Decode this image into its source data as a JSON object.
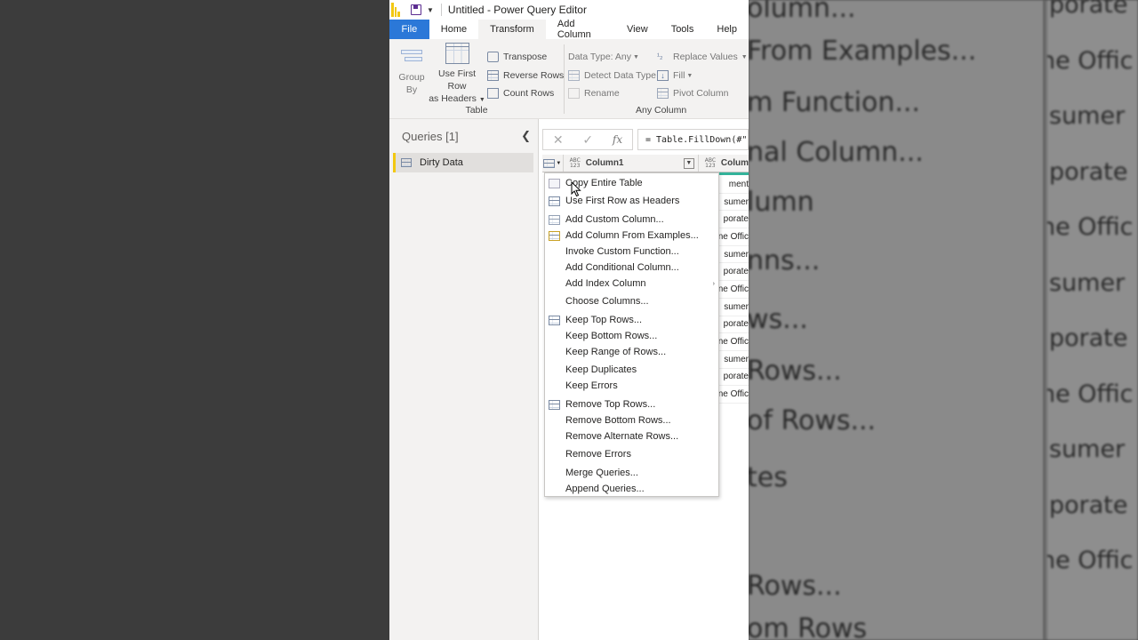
{
  "window": {
    "title": "Untitled - Power Query Editor"
  },
  "tabs": [
    "File",
    "Home",
    "Transform",
    "Add Column",
    "View",
    "Tools",
    "Help"
  ],
  "active_tab": "Transform",
  "ribbon": {
    "group_by": {
      "line1": "Group",
      "line2": "By"
    },
    "use_first_row": {
      "line1": "Use First Row",
      "line2": "as Headers"
    },
    "transpose": "Transpose",
    "reverse_rows": "Reverse Rows",
    "count_rows": "Count Rows",
    "table_group": "Table",
    "data_type": "Data Type: Any",
    "detect_data_type": "Detect Data Type",
    "rename": "Rename",
    "replace_values": "Replace Values",
    "fill": "Fill",
    "pivot_column": "Pivot Column",
    "any_column_group": "Any Column"
  },
  "queries_pane": {
    "header": "Queries [1]",
    "items": [
      "Dirty Data"
    ]
  },
  "formula_bar": {
    "formula": "= Table.FillDown(#\""
  },
  "grid": {
    "columns": [
      "Column1",
      "Colum"
    ],
    "column_type": "ABC\n123",
    "visible_cells": [
      "ment",
      "sumer",
      "porate",
      "ne Offic",
      "sumer",
      "porate",
      "ne Offic",
      "sumer",
      "porate",
      "ne Offic",
      "sumer",
      "porate",
      "ne Offic"
    ]
  },
  "context_menu": {
    "items": [
      {
        "label": "Copy Entire Table",
        "icon": "copy-table-icon"
      },
      {
        "label": "Use First Row as Headers",
        "icon": "table-icon"
      },
      {
        "label": "Add Custom Column...",
        "icon": "custom-column-icon"
      },
      {
        "label": "Add Column From Examples...",
        "icon": "column-examples-icon"
      },
      {
        "label": "Invoke Custom Function...",
        "icon": ""
      },
      {
        "label": "Add Conditional Column...",
        "icon": ""
      },
      {
        "label": "Add Index Column",
        "icon": "",
        "submenu": true
      },
      {
        "label": "Choose Columns...",
        "icon": ""
      },
      {
        "label": "Keep Top Rows...",
        "icon": "keep-rows-icon"
      },
      {
        "label": "Keep Bottom Rows...",
        "icon": ""
      },
      {
        "label": "Keep Range of Rows...",
        "icon": ""
      },
      {
        "label": "Keep Duplicates",
        "icon": ""
      },
      {
        "label": "Keep Errors",
        "icon": ""
      },
      {
        "label": "Remove Top Rows...",
        "icon": "remove-rows-icon"
      },
      {
        "label": "Remove Bottom Rows...",
        "icon": ""
      },
      {
        "label": "Remove Alternate Rows...",
        "icon": ""
      },
      {
        "label": "Remove Errors",
        "icon": ""
      },
      {
        "label": "Merge Queries...",
        "icon": ""
      },
      {
        "label": "Append Queries...",
        "icon": ""
      }
    ]
  },
  "zoomed_background": {
    "menu_lines": [
      "olumn...",
      "From Examples...",
      "m Function...",
      "nal Column...",
      "lumn",
      "nns...",
      "ws...",
      "Rows...",
      "of Rows...",
      "tes",
      "Rows...",
      "om Rows"
    ],
    "cell_lines": [
      "porate",
      "ne Offic",
      "sumer",
      "porate",
      "ne Offic",
      "sumer",
      "porate",
      "ne Offic",
      "sumer",
      "porate",
      "ne Offic"
    ]
  },
  "colors": {
    "file_tab": "#2b78d8",
    "brand_yellow": "#f2c811",
    "ribbon_bg": "#f3f2f1",
    "header_accent": "#33b39a"
  }
}
